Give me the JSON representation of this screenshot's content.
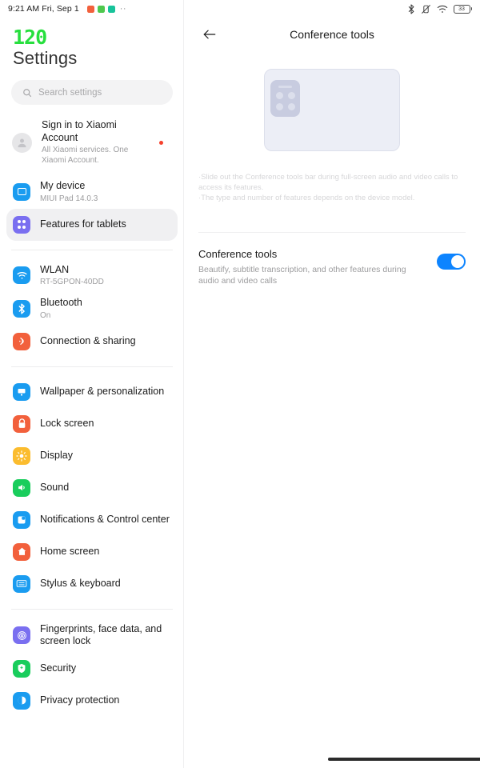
{
  "status_bar": {
    "clock": "9:21 AM Fri, Sep 1",
    "app_icons": [
      {
        "name": "notification-app-orange",
        "color": "#f2603c"
      },
      {
        "name": "notification-app-green",
        "color": "#4ec84e"
      },
      {
        "name": "notification-app-teal",
        "color": "#18c39a"
      }
    ],
    "overflow": "··",
    "right_icons": [
      "bluetooth-icon",
      "vibrate-off-icon",
      "wifi-icon"
    ],
    "battery_level": "33"
  },
  "sidebar": {
    "refresh_badge": "120",
    "title": "Settings",
    "search": {
      "placeholder": "Search settings",
      "icon": "search-icon"
    },
    "account": {
      "title": "Sign in to Xiaomi Account",
      "subtitle": "All Xiaomi services. One Xiaomi Account.",
      "icon": "person-avatar-icon",
      "badge": "red-dot"
    },
    "groups": [
      {
        "items": [
          {
            "label": "My device",
            "sub": "MIUI Pad 14.0.3",
            "icon": "device-icon",
            "color": "#1a9cf0",
            "selected": false
          },
          {
            "label": "Features for tablets",
            "sub": "",
            "icon": "grid-dots-icon",
            "color": "#7a6ff0",
            "selected": true
          }
        ]
      },
      {
        "items": [
          {
            "label": "WLAN",
            "sub": "RT-5GPON-40DD",
            "icon": "wifi-icon",
            "color": "#1a9cf0",
            "selected": false
          },
          {
            "label": "Bluetooth",
            "sub": "On",
            "icon": "bluetooth-icon",
            "color": "#1a9cf0",
            "selected": false
          },
          {
            "label": "Connection & sharing",
            "sub": "",
            "icon": "connection-sharing-icon",
            "color": "#f2603c",
            "selected": false
          }
        ]
      },
      {
        "items": [
          {
            "label": "Wallpaper & personalization",
            "sub": "",
            "icon": "wallpaper-icon",
            "color": "#1a9cf0",
            "selected": false
          },
          {
            "label": "Lock screen",
            "sub": "",
            "icon": "lock-icon",
            "color": "#f2603c",
            "selected": false
          },
          {
            "label": "Display",
            "sub": "",
            "icon": "brightness-icon",
            "color": "#fbbc2e",
            "selected": false
          },
          {
            "label": "Sound",
            "sub": "",
            "icon": "speaker-icon",
            "color": "#19cd5c",
            "selected": false
          },
          {
            "label": "Notifications & Control center",
            "sub": "",
            "icon": "notifications-icon",
            "color": "#1a9cf0",
            "selected": false
          },
          {
            "label": "Home screen",
            "sub": "",
            "icon": "home-icon",
            "color": "#f2603c",
            "selected": false
          },
          {
            "label": "Stylus & keyboard",
            "sub": "",
            "icon": "keyboard-icon",
            "color": "#1a9cf0",
            "selected": false
          }
        ]
      },
      {
        "items": [
          {
            "label": "Fingerprints, face data, and screen lock",
            "sub": "",
            "icon": "fingerprint-icon",
            "color": "#7a6ff0",
            "selected": false
          },
          {
            "label": "Security",
            "sub": "",
            "icon": "shield-icon",
            "color": "#19cd5c",
            "selected": false
          },
          {
            "label": "Privacy protection",
            "sub": "",
            "icon": "privacy-icon",
            "color": "#1a9cf0",
            "selected": false
          }
        ]
      }
    ]
  },
  "content": {
    "back_icon": "back-arrow-icon",
    "title": "Conference tools",
    "illustration": {
      "name": "conference-tools-bar-illustration",
      "panel_dots": 4
    },
    "description_lines": [
      "·Slide out the Conference tools bar during full-screen audio and video calls to access its features.",
      "·The type and number of features depends on the device model."
    ],
    "setting": {
      "title": "Conference tools",
      "description": "Beautify, subtitle transcription, and other features during audio and video calls",
      "enabled": true,
      "accent": "#0d84ff"
    }
  }
}
